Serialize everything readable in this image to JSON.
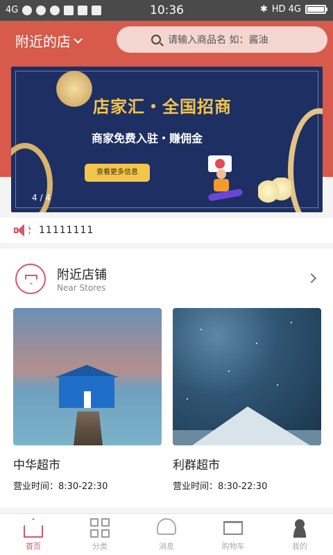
{
  "status_bar": {
    "network_label": "4G",
    "time": "10:36",
    "right_label": "HD 4G"
  },
  "header": {
    "location_label": "附近的店",
    "search_placeholder": "请输入商品名  如：酱油"
  },
  "banner": {
    "title": "店家汇・全国招商",
    "subtitle": "商家免费入驻・赚佣金",
    "button_label": "查看更多信息",
    "page_indicator": "4 / 4"
  },
  "notice": {
    "text": "11111111"
  },
  "nearby": {
    "title": "附近店铺",
    "subtitle": "Near Stores",
    "stores": [
      {
        "name": "中华超市",
        "hours": "营业时间：8:30-22:30"
      },
      {
        "name": "利群超市",
        "hours": "营业时间：8:30-22:30"
      }
    ]
  },
  "tabbar": {
    "tabs": [
      {
        "label": "首页",
        "icon": "home-icon",
        "active": true
      },
      {
        "label": "分类",
        "icon": "grid-icon",
        "active": false
      },
      {
        "label": "消息",
        "icon": "bell-icon",
        "active": false
      },
      {
        "label": "购物车",
        "icon": "cart-icon",
        "active": false
      },
      {
        "label": "我的",
        "icon": "user-icon",
        "active": false
      }
    ]
  },
  "colors": {
    "brand_red": "#d75a4a",
    "accent_pink": "#d8566a",
    "banner_navy": "#1d2f63",
    "banner_gold": "#f3c54b"
  }
}
